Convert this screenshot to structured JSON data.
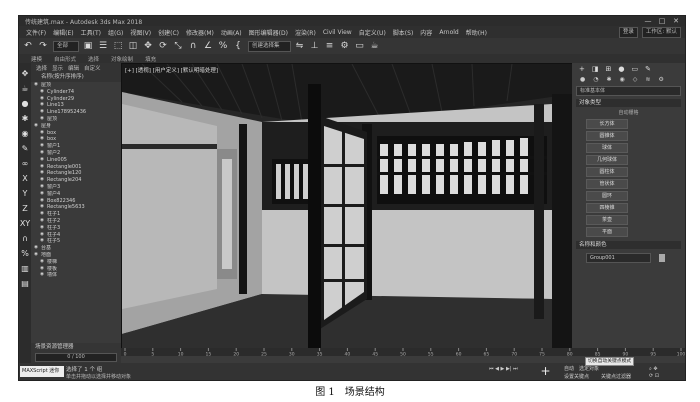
{
  "window": {
    "title": "传统建筑.max - Autodesk 3ds Max 2018",
    "controls": [
      "—",
      "□",
      "✕"
    ]
  },
  "menu": {
    "items": [
      "文件(F)",
      "编辑(E)",
      "工具(T)",
      "组(G)",
      "视图(V)",
      "创建(C)",
      "修改器(M)",
      "动画(A)",
      "图形编辑器(D)",
      "渲染(R)",
      "Civil View",
      "自定义(U)",
      "脚本(S)",
      "内容",
      "Arnold",
      "帮助(H)"
    ],
    "sign_in": "登录",
    "workspace": "工作区: 默认"
  },
  "toolbar": {
    "filter": "全部",
    "selection_set": "创建选择集"
  },
  "ribbon": [
    "建模",
    "自由形式",
    "选择",
    "对象绘制",
    "填充"
  ],
  "explorer": {
    "tabs": [
      "选择",
      "显示",
      "编辑",
      "自定义"
    ],
    "header": "名称(按升序排序)",
    "rows": [
      "屋顶",
      "Cylinder74",
      "Cylinder29",
      "Line13",
      "Line178952436",
      "屋顶",
      "屋身",
      "box",
      "box",
      "窗户1",
      "窗户2",
      "Line005",
      "Rectangle001",
      "Rectangle120",
      "Rectangle204",
      "窗户3",
      "窗户4",
      "Box822346",
      "Rectangle5633",
      "柱子1",
      "柱子2",
      "柱子3",
      "柱子4",
      "柱子5",
      "台基",
      "地面",
      "楼梯",
      "楼板",
      "墙体"
    ],
    "footer_label": "场景资源管理器",
    "layer": "0 / 100"
  },
  "viewport": {
    "label": "[+] [透视] [用户定义] [默认明暗处理]"
  },
  "command_panel": {
    "dropdown": "标准基本体",
    "rollout1": "对象类型",
    "autogrid": "自动栅格",
    "buttons": [
      "长方体",
      "圆锥体",
      "球体",
      "几何球体",
      "圆柱体",
      "管状体",
      "圆环",
      "四棱锥",
      "茶壶",
      "平面"
    ],
    "rollout2": "名称和颜色",
    "name_value": "Group001"
  },
  "timeline": {
    "ticks": [
      "0",
      "5",
      "10",
      "15",
      "20",
      "25",
      "30",
      "35",
      "40",
      "45",
      "50",
      "55",
      "60",
      "65",
      "70",
      "75",
      "80",
      "85",
      "90",
      "95",
      "100"
    ]
  },
  "status": {
    "maxscript": "MAXScript 迷你",
    "line1": "选择了 1 个 组",
    "line2": "单击并拖动以选择并移动对象",
    "tooltip": "切换自动关键点模式",
    "auto_key": "自动",
    "selected": "选定对象",
    "set_key": "设置关键点",
    "filters": "关键点过滤器"
  },
  "caption": "图 1　场景结构"
}
